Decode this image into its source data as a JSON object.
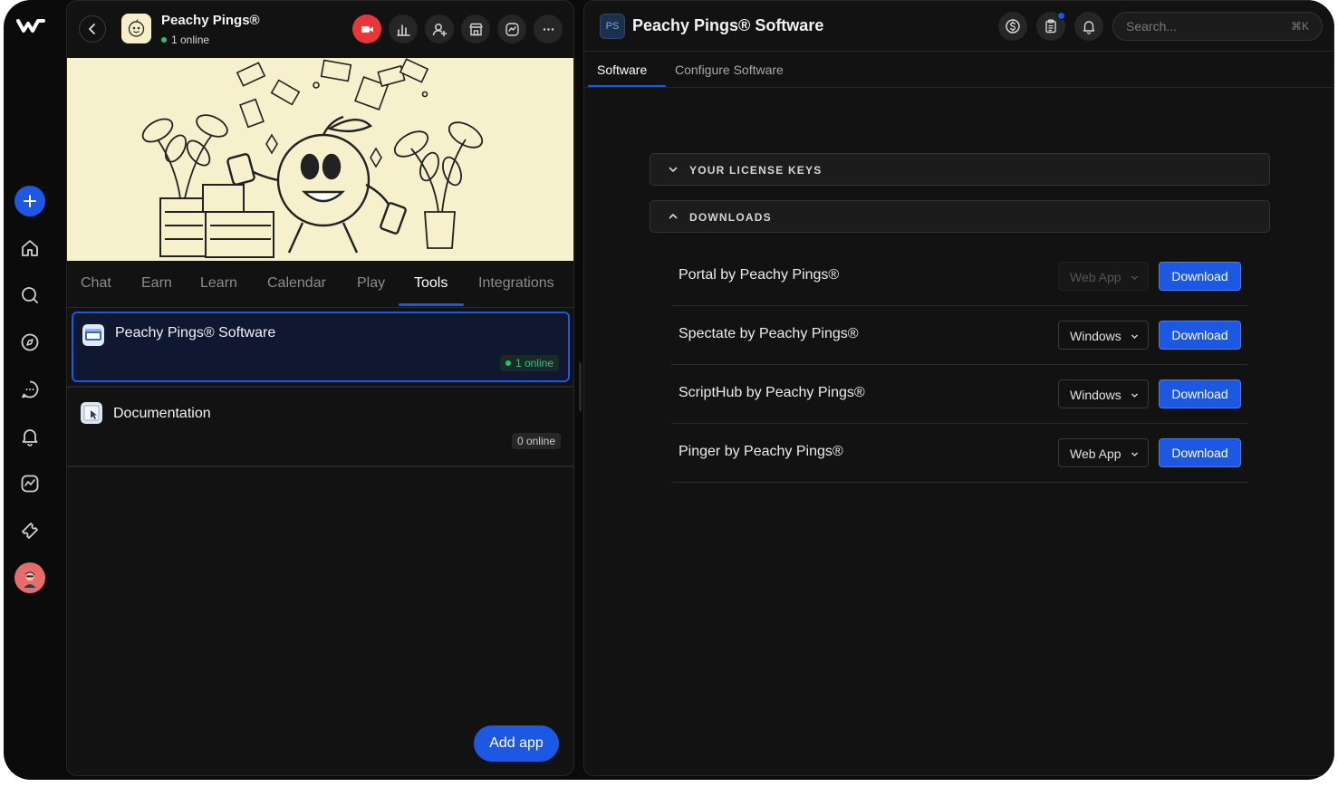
{
  "hub": {
    "name": "Peachy Pings®",
    "online": "1 online"
  },
  "left_tabs": [
    "Chat",
    "Earn",
    "Learn",
    "Calendar",
    "Play",
    "Tools",
    "Integrations"
  ],
  "active_left_tab": "Tools",
  "apps": [
    {
      "title": "Peachy Pings® Software",
      "online": "1 online",
      "selected": true
    },
    {
      "title": "Documentation",
      "online": "0 online",
      "selected": false
    }
  ],
  "add_app_label": "Add app",
  "right": {
    "ps_chip": "PS",
    "title": "Peachy Pings® Software",
    "search_placeholder": "Search...",
    "search_shortcut": "⌘K",
    "tabs": [
      "Software",
      "Configure Software"
    ],
    "active_tab": "Software",
    "sections": {
      "license_keys": "YOUR LICENSE KEYS",
      "downloads": "DOWNLOADS"
    },
    "downloads": [
      {
        "name": "Portal by Peachy Pings®",
        "platform": "Web App",
        "platform_disabled": true,
        "button": "Download"
      },
      {
        "name": "Spectate by Peachy Pings®",
        "platform": "Windows",
        "platform_disabled": false,
        "button": "Download"
      },
      {
        "name": "ScriptHub by Peachy Pings®",
        "platform": "Windows",
        "platform_disabled": false,
        "button": "Download"
      },
      {
        "name": "Pinger by Peachy Pings®",
        "platform": "Web App",
        "platform_disabled": false,
        "button": "Download"
      }
    ]
  },
  "icons": {
    "rail": [
      "logo-icon",
      "plus-icon",
      "home-icon",
      "search-icon",
      "compass-icon",
      "chat-icon",
      "bell-icon",
      "chart-icon",
      "ticket-icon",
      "avatar"
    ],
    "header_left": [
      "back-icon",
      "video-icon",
      "stats-icon",
      "add-user-icon",
      "store-icon",
      "activity-icon",
      "more-icon"
    ],
    "header_right": [
      "dollar-icon",
      "clipboard-icon",
      "bell-icon"
    ]
  },
  "colors": {
    "accent": "#1d58e3",
    "online": "#2fbf71",
    "live": "#e8373a",
    "banner": "#f6f0cc"
  }
}
